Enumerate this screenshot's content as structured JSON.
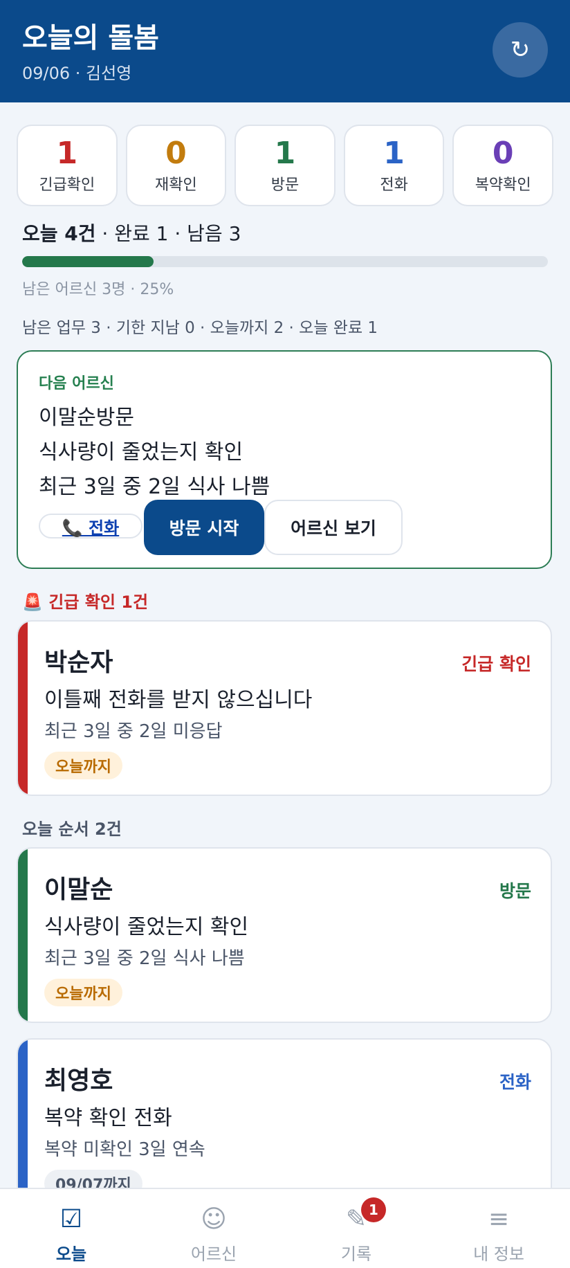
{
  "header": {
    "title": "오늘의 돌봄",
    "subtitle": "09/06 · 김선영",
    "refresh_icon": "↻"
  },
  "stats": [
    {
      "value": "1",
      "label": "긴급확인",
      "color": "#c62828"
    },
    {
      "value": "0",
      "label": "재확인",
      "color": "#c27c0e"
    },
    {
      "value": "1",
      "label": "방문",
      "color": "#24784b"
    },
    {
      "value": "1",
      "label": "전화",
      "color": "#2b63c6"
    },
    {
      "value": "0",
      "label": "복약확인",
      "color": "#6a3fb6"
    }
  ],
  "progress": {
    "today_label": "오늘 4건",
    "rest": " · 완료 1 · 남음 3",
    "percent": 25,
    "remaining_text": "남은 어르신 3명 · 25%"
  },
  "tasks_summary": "남은 업무 3 · 기한 지남 0 · 오늘까지 2 · 오늘 완료 1",
  "next": {
    "kicker": "다음 어르신",
    "line1": "이말순방문",
    "line2": "식사량이 줄었는지 확인",
    "line3": "최근 3일 중 2일 식사 나쁨",
    "call_label": "📞 전화",
    "visit_label": "방문 시작",
    "view_label": "어르신 보기"
  },
  "urgent_section": "🚨 긴급 확인 1건",
  "order_section": "오늘 순서 2건",
  "cards": [
    {
      "name": "박순자",
      "type": "긴급 확인",
      "desc": "이틀째 전화를 받지 않으십니다",
      "meta": "최근 3일 중 2일 미응답",
      "due": "오늘까지",
      "color": "#c62828"
    },
    {
      "name": "이말순",
      "type": "방문",
      "desc": "식사량이 줄었는지 확인",
      "meta": "최근 3일 중 2일 식사 나쁨",
      "due": "오늘까지",
      "color": "#24784b"
    },
    {
      "name": "최영호",
      "type": "전화",
      "desc": "복약 확인 전화",
      "meta": "복약 미확인 3일 연속",
      "due": "09/07까지",
      "color": "#2b63c6"
    }
  ],
  "nav": [
    {
      "icon": "☑",
      "icon_name": "checkbox-icon",
      "label": "오늘",
      "active": true
    },
    {
      "icon": "☺",
      "icon_name": "smiley-icon",
      "label": "어르신"
    },
    {
      "icon": "✎",
      "icon_name": "pencil-icon",
      "label": "기록",
      "badge": "1"
    },
    {
      "icon": "≡",
      "icon_name": "menu-icon",
      "label": "내 정보"
    }
  ]
}
